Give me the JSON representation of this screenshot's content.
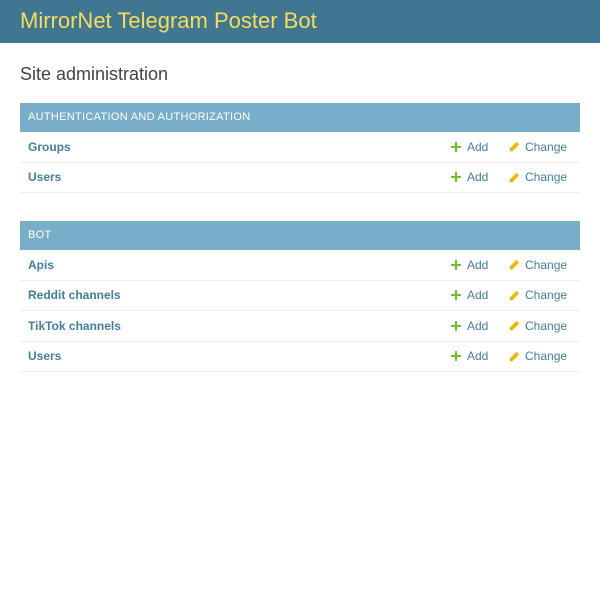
{
  "header": {
    "title": "MirrorNet Telegram Poster Bot"
  },
  "page_title": "Site administration",
  "actions": {
    "add_label": "Add",
    "change_label": "Change"
  },
  "colors": {
    "header_bg": "#417690",
    "branding": "#f5dd5d",
    "caption_bg": "#79aec8",
    "link": "#447e9b",
    "add_icon": "#70bf2b",
    "change_icon": "#efb80b"
  },
  "modules": [
    {
      "caption": "AUTHENTICATION AND AUTHORIZATION",
      "models": [
        "Groups",
        "Users"
      ]
    },
    {
      "caption": "BOT",
      "models": [
        "Apis",
        "Reddit channels",
        "TikTok channels",
        "Users"
      ]
    }
  ],
  "icons": {
    "add": "plus-icon",
    "change": "pencil-icon"
  }
}
